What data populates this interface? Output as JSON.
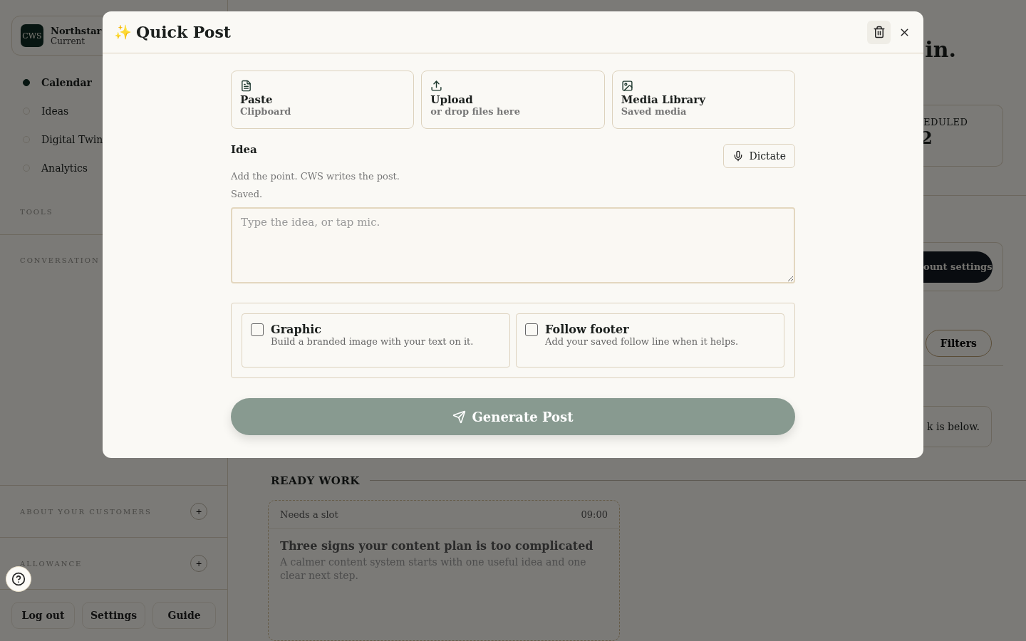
{
  "sidebar": {
    "workspace": {
      "logo": "CWS",
      "name": "Northstar",
      "status": "Current"
    },
    "nav": [
      {
        "label": "Calendar",
        "selected": true
      },
      {
        "label": "Ideas",
        "selected": false
      },
      {
        "label": "Digital Twin",
        "selected": false
      },
      {
        "label": "Analytics",
        "selected": false
      }
    ],
    "sections": [
      "TOOLS",
      "CONVERSATION"
    ],
    "panels": [
      {
        "title": "ABOUT YOUR CUSTOMERS",
        "toggle": "+"
      },
      {
        "title": "ALLOWANCE",
        "toggle": "+"
      }
    ],
    "footer_buttons": [
      "Log out",
      "Settings",
      "Guide"
    ]
  },
  "main": {
    "heading": "in.",
    "stat": {
      "label": "EDULED",
      "value": "2"
    },
    "settings_button": "ount settings",
    "filters_button": "Filters",
    "notice": "k is below.",
    "ready_work": {
      "title": "READY WORK",
      "card": {
        "status": "Needs a slot",
        "time": "09:00",
        "title": "Three signs your content plan is too complicated",
        "body": "A calmer content system starts with one useful idea and one clear next step."
      }
    }
  },
  "dialog": {
    "icon": "✨",
    "title": "Quick Post",
    "sources": [
      {
        "kind": "paste",
        "title": "Paste",
        "subtitle": "Clipboard"
      },
      {
        "kind": "upload",
        "title": "Upload",
        "subtitle": "or drop files here"
      },
      {
        "kind": "media",
        "title": "Media Library",
        "subtitle": "Saved media"
      }
    ],
    "idea": {
      "label": "Idea",
      "dictate": "Dictate",
      "hint": "Add the point. CWS writes the post.",
      "status": "Saved.",
      "placeholder": "Type the idea, or tap mic."
    },
    "options": [
      {
        "title": "Graphic",
        "description": "Build a branded image with your text on it.",
        "checked": false
      },
      {
        "title": "Follow footer",
        "description": "Add your saved follow line when it helps.",
        "checked": false
      }
    ],
    "generate": {
      "label": "Generate Post",
      "disabled": true
    }
  }
}
